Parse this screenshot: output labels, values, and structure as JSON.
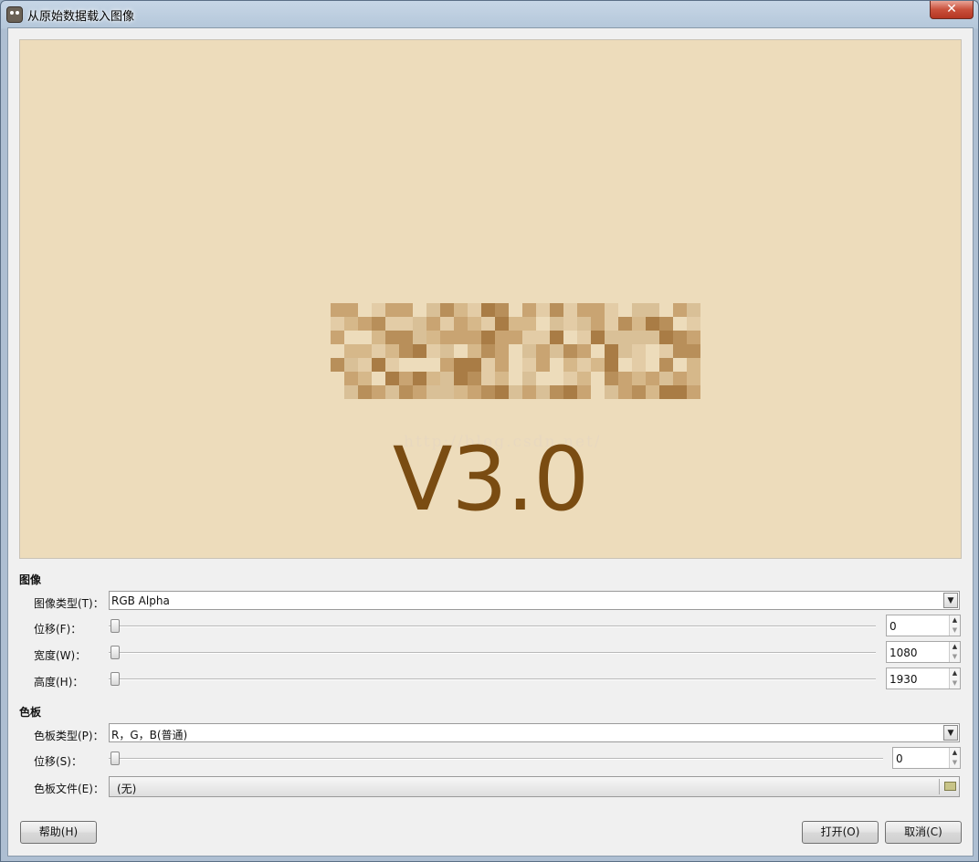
{
  "window": {
    "title": "从原始数据载入图像",
    "close_glyph": "✕"
  },
  "preview": {
    "watermark": "http://blog.csdn.net/",
    "version_text": "V3.0",
    "colors": {
      "background": "#eddcbb",
      "text": "#7a4c12"
    }
  },
  "image_section": {
    "heading": "图像",
    "type_label": "图像类型(T)：",
    "type_value": "RGB Alpha",
    "offset_label": "位移(F)：",
    "offset_value": "0",
    "width_label": "宽度(W)：",
    "width_value": "1080",
    "height_label": "高度(H)：",
    "height_value": "1930"
  },
  "palette_section": {
    "heading": "色板",
    "type_label": "色板类型(P)：",
    "type_value": "R，G，B(普通)",
    "offset_label": "位移(S)：",
    "offset_value": "0",
    "file_label": "色板文件(E)：",
    "file_value": "(无)"
  },
  "buttons": {
    "help": "帮助(H)",
    "open": "打开(O)",
    "cancel": "取消(C)"
  }
}
